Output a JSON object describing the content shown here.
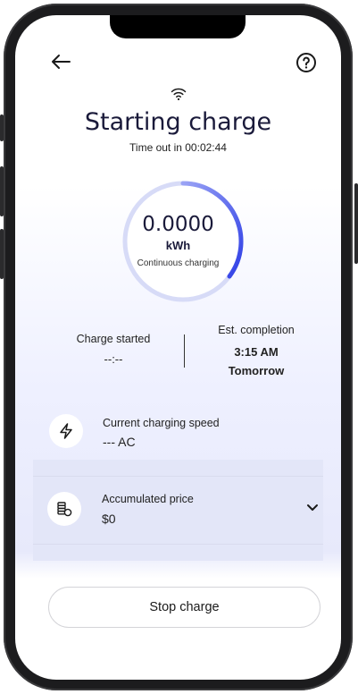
{
  "header": {
    "back_icon": "arrow-left-icon",
    "help_icon": "question-circle-icon",
    "signal_icon": "wifi-icon"
  },
  "status": {
    "title": "Starting charge",
    "timeout": "Time out in 00:02:44"
  },
  "gauge": {
    "value": "0.0000",
    "unit": "kWh",
    "note": "Continuous charging",
    "accent_color": "#3d4ef0"
  },
  "stats": {
    "started_label": "Charge started",
    "started_value": "--:--",
    "completion_label": "Est. completion",
    "completion_time": "3:15 AM",
    "completion_day": "Tomorrow"
  },
  "speed": {
    "icon": "lightning-icon",
    "label": "Current charging speed",
    "value": "--- AC"
  },
  "price": {
    "icon": "coins-icon",
    "label": "Accumulated price",
    "value": "$0",
    "expand_icon": "chevron-down-icon"
  },
  "actions": {
    "stop_label": "Stop charge"
  }
}
